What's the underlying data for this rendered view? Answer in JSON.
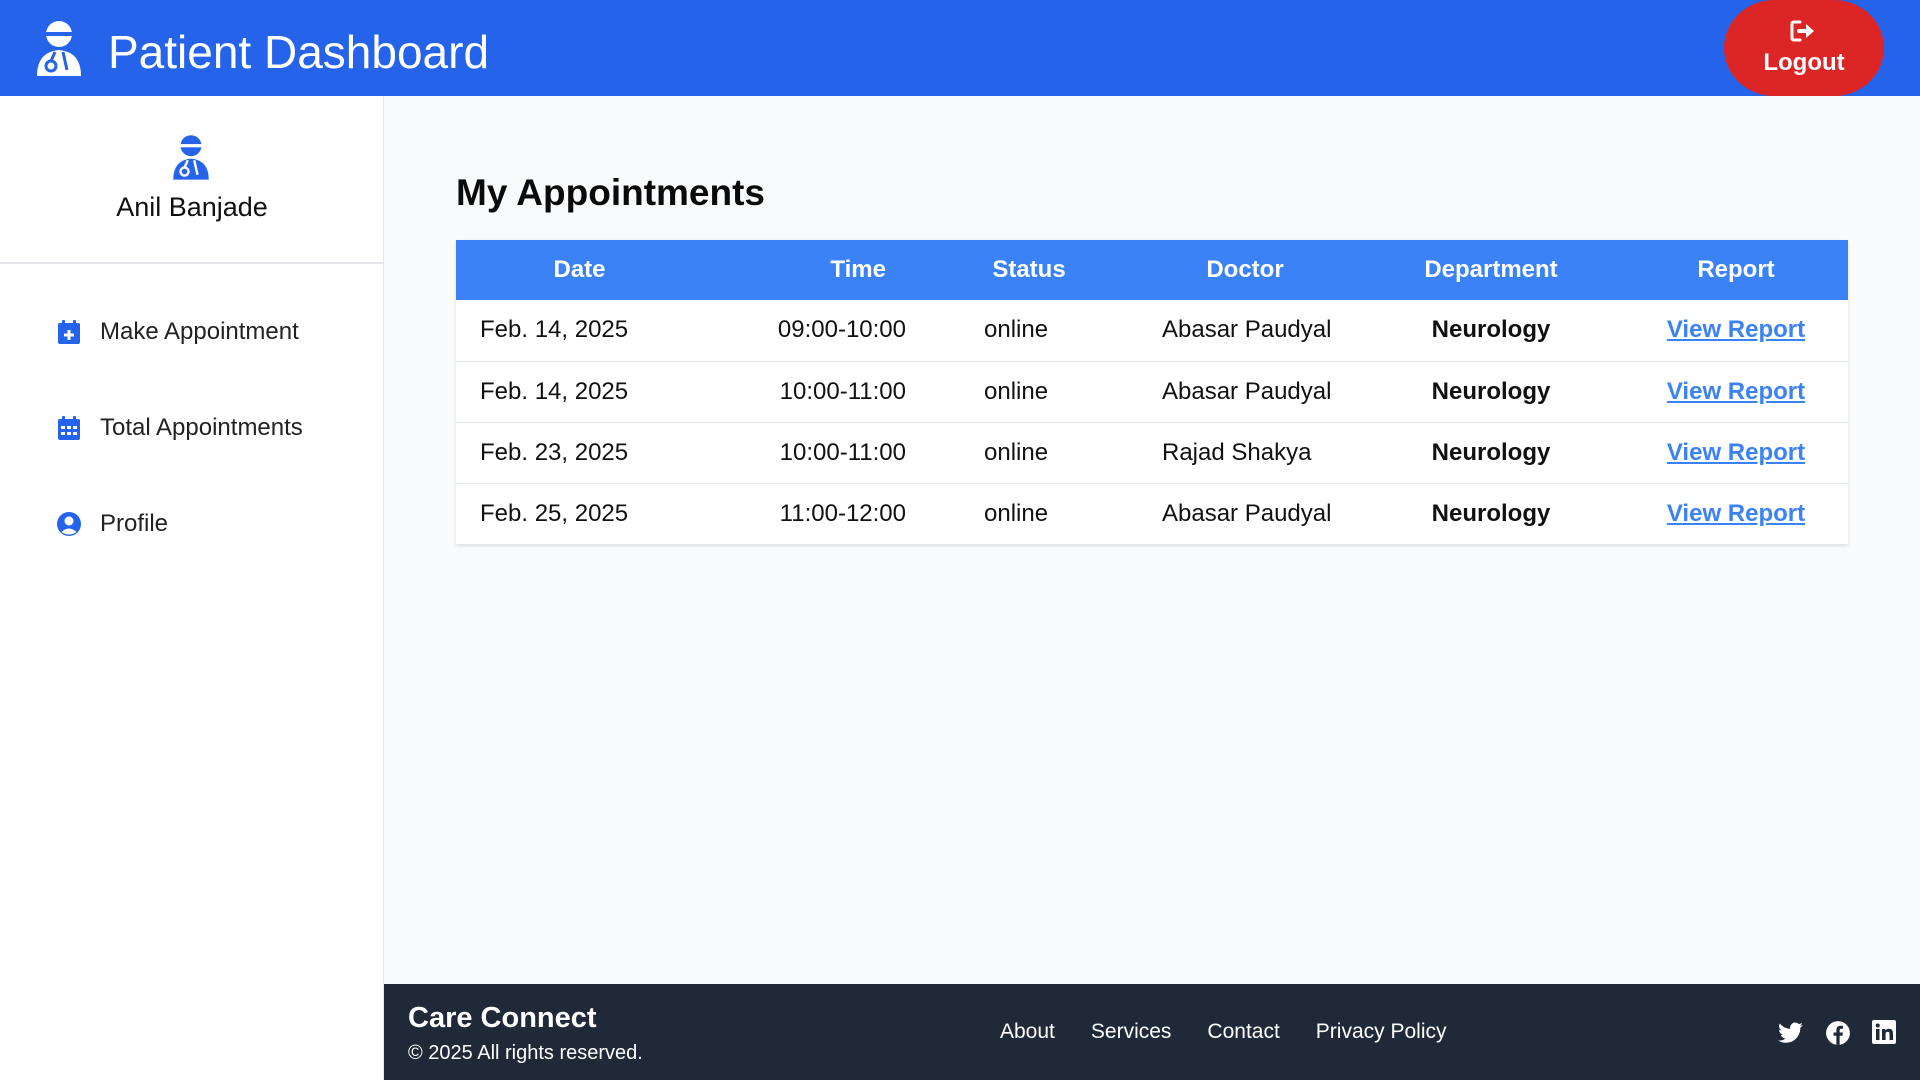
{
  "header": {
    "title": "Patient Dashboard",
    "logout_label": "Logout",
    "brand_icon": "user-doctor-icon",
    "logout_icon": "sign-out-icon"
  },
  "sidebar": {
    "user_name": "Anil Banjade",
    "avatar_icon": "user-doctor-icon",
    "items": [
      {
        "label": "Make Appointment",
        "icon": "calendar-plus-icon"
      },
      {
        "label": "Total Appointments",
        "icon": "calendar-days-icon"
      },
      {
        "label": "Profile",
        "icon": "user-circle-icon"
      }
    ]
  },
  "main": {
    "title": "My Appointments",
    "columns": [
      "Date",
      "Time",
      "Status",
      "Doctor",
      "Department",
      "Report"
    ],
    "rows": [
      {
        "date": "Feb. 14, 2025",
        "time": "09:00-10:00",
        "status": "online",
        "doctor": "Abasar Paudyal",
        "department": "Neurology",
        "report": "View Report"
      },
      {
        "date": "Feb. 14, 2025",
        "time": "10:00-11:00",
        "status": "online",
        "doctor": "Abasar Paudyal",
        "department": "Neurology",
        "report": "View Report"
      },
      {
        "date": "Feb. 23, 2025",
        "time": "10:00-11:00",
        "status": "online",
        "doctor": "Rajad Shakya",
        "department": "Neurology",
        "report": "View Report"
      },
      {
        "date": "Feb. 25, 2025",
        "time": "11:00-12:00",
        "status": "online",
        "doctor": "Abasar Paudyal",
        "department": "Neurology",
        "report": "View Report"
      }
    ]
  },
  "footer": {
    "brand": "Care Connect",
    "copyright": "© 2025 All rights reserved.",
    "links": [
      "About",
      "Services",
      "Contact",
      "Privacy Policy"
    ],
    "social": [
      "twitter-icon",
      "facebook-icon",
      "linkedin-icon"
    ]
  },
  "colors": {
    "header_bg": "#2563eb",
    "logout_bg": "#dc2626",
    "table_header_bg": "#3b82f6",
    "link": "#3b82f6",
    "footer_bg": "#1f2937"
  }
}
